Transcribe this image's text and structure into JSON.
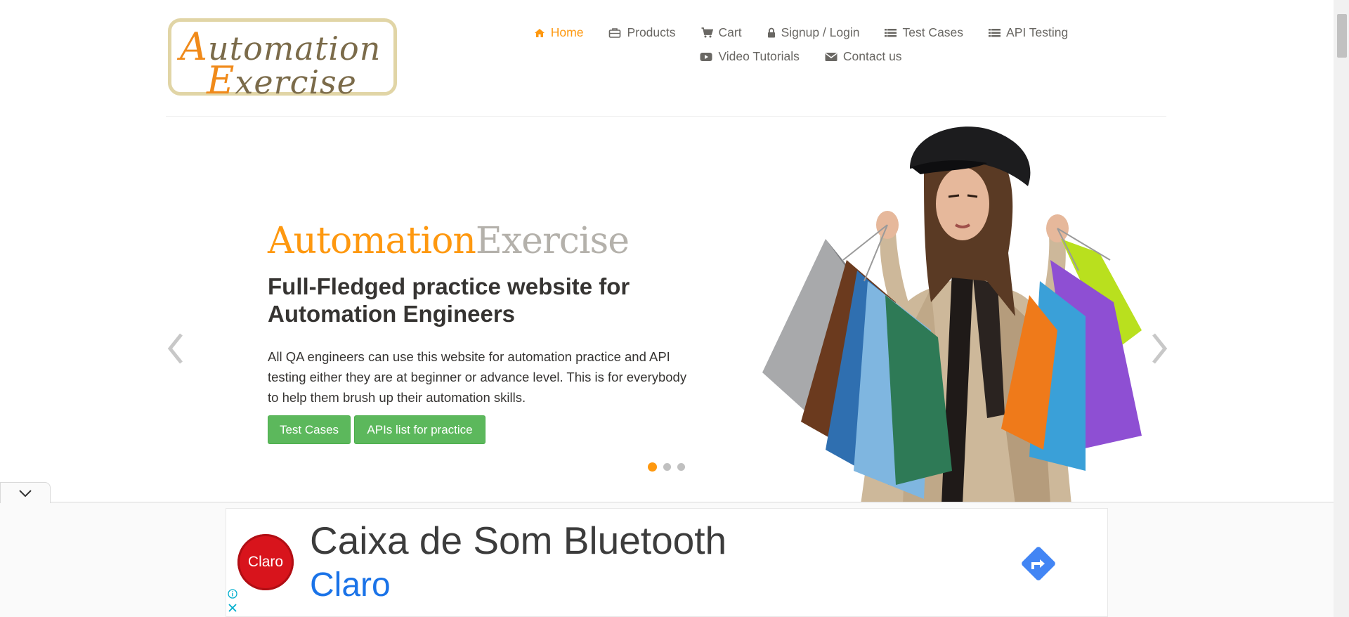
{
  "logo": {
    "line1_cap": "A",
    "line1_rest": "utomation",
    "line2_cap": "E",
    "line2_rest": "xercise"
  },
  "nav": {
    "items": [
      {
        "label": "Home",
        "icon": "home-icon",
        "active": true
      },
      {
        "label": "Products",
        "icon": "products-icon"
      },
      {
        "label": "Cart",
        "icon": "cart-icon"
      },
      {
        "label": "Signup / Login",
        "icon": "lock-icon"
      },
      {
        "label": "Test Cases",
        "icon": "list-icon"
      },
      {
        "label": "API Testing",
        "icon": "list-icon"
      },
      {
        "label": "Video Tutorials",
        "icon": "youtube-icon"
      },
      {
        "label": "Contact us",
        "icon": "envelope-icon"
      }
    ]
  },
  "slider": {
    "title_part1": "Automation",
    "title_part2": "Exercise",
    "heading": "Full-Fledged practice website for Automation Engineers",
    "description": "All QA engineers can use this website for automation practice and API testing either they are at beginner or advance level. This is for everybody to help them brush up their automation skills.",
    "buttons": {
      "test_cases": "Test Cases",
      "apis": "APIs list for practice"
    },
    "active_slide": 1,
    "slide_count": 3
  },
  "ad": {
    "logo_text": "Claro",
    "title": "Caixa de Som Bluetooth",
    "brand": "Claro"
  },
  "colors": {
    "accent": "#fe980f",
    "button_green": "#5cb85c",
    "ad_link": "#1a73e8",
    "claro_red": "#d8141c"
  }
}
